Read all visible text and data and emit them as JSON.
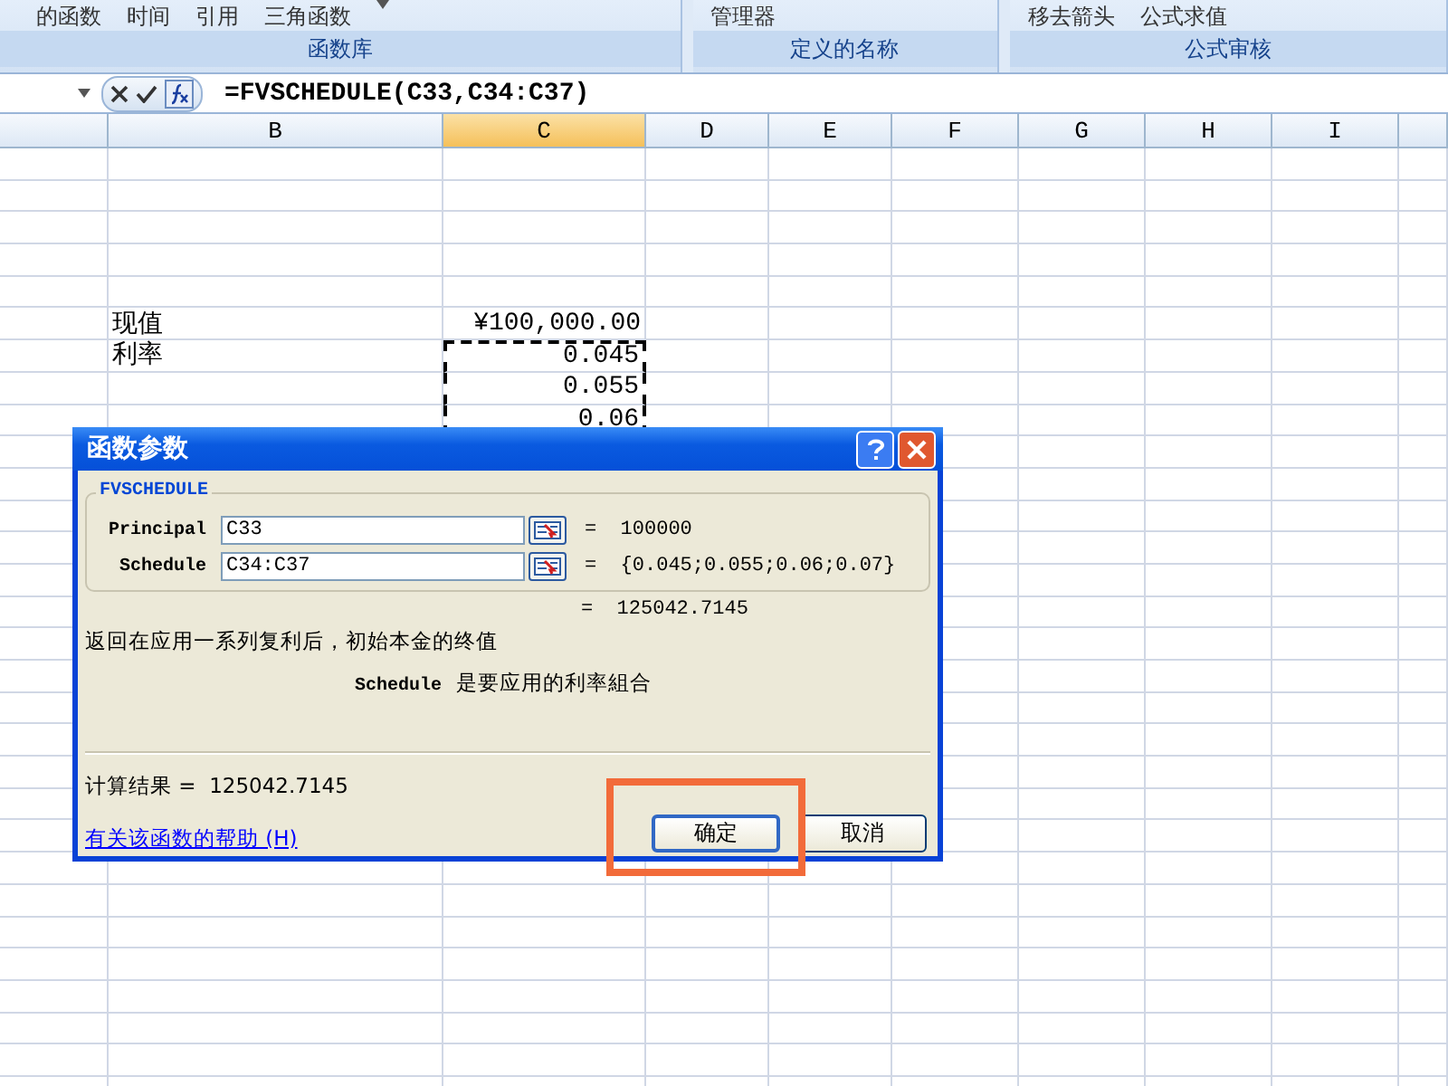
{
  "ribbon": {
    "groups": [
      {
        "label": "函数库",
        "items": [
          "的函数",
          "时间",
          "引用",
          "三角函数"
        ]
      },
      {
        "label": "定义的名称",
        "items": [
          "管理器"
        ]
      },
      {
        "label": "公式审核",
        "items": [
          "移去箭头",
          "公式求值"
        ]
      }
    ]
  },
  "formula_bar": {
    "formula": "=FVSCHEDULE(C33,C34:C37)"
  },
  "columns": [
    {
      "label": "B",
      "selected": false
    },
    {
      "label": "C",
      "selected": true
    },
    {
      "label": "D",
      "selected": false
    },
    {
      "label": "E",
      "selected": false
    },
    {
      "label": "F",
      "selected": false
    },
    {
      "label": "G",
      "selected": false
    },
    {
      "label": "H",
      "selected": false
    },
    {
      "label": "I",
      "selected": false
    }
  ],
  "entries": [
    {
      "label": "现值",
      "value": "¥100,000.00",
      "marquee": false
    },
    {
      "label": "利率",
      "value": "0.045",
      "marquee": true
    },
    {
      "value": "0.055",
      "marquee": true
    },
    {
      "value": "0.06",
      "marquee": true
    }
  ],
  "dialog": {
    "title": "函数参数",
    "function_name": "FVSCHEDULE",
    "arguments": [
      {
        "name": "Principal",
        "value": "C33",
        "result": "=  100000"
      },
      {
        "name": "Schedule",
        "value": "C34:C37",
        "result": "=  {0.045;0.055;0.06;0.07}"
      }
    ],
    "result": "=  125042.7145",
    "description": "返回在应用一系列复利后，初始本金的终值",
    "argument_help": {
      "name": "Schedule",
      "text": "是要应用的利率組合"
    },
    "formula_result": "计算结果 =  125042.7145",
    "help_link": "有关该函数的帮助 (H)",
    "buttons": [
      {
        "label": "确定",
        "default": true,
        "highlighted": true
      },
      {
        "label": "取消",
        "default": false,
        "highlighted": false
      }
    ]
  }
}
